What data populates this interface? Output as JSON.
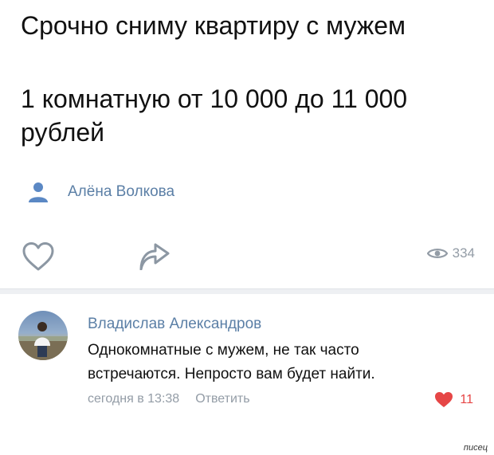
{
  "post": {
    "lines": [
      "Срочно сниму квартиру с мужем",
      "1 комнатную от 10 000 до 11 000",
      "рублей"
    ],
    "author": "Алёна Волкова",
    "views": "334"
  },
  "comment": {
    "author": "Владислав Александров",
    "text_lines": [
      "Однокомнатные с мужем, не так часто",
      "встречаются. Непросто вам будет найти."
    ],
    "timestamp": "сегодня в 13:38",
    "reply_label": "Ответить",
    "likes": "11"
  },
  "watermark": "писец",
  "colors": {
    "link": "#5b7fa6",
    "meta": "#939ca6",
    "like": "#e64646",
    "divider": "#eef0f3"
  },
  "icons": [
    "person-icon",
    "heart-outline-icon",
    "share-icon",
    "eye-icon",
    "heart-filled-icon"
  ]
}
